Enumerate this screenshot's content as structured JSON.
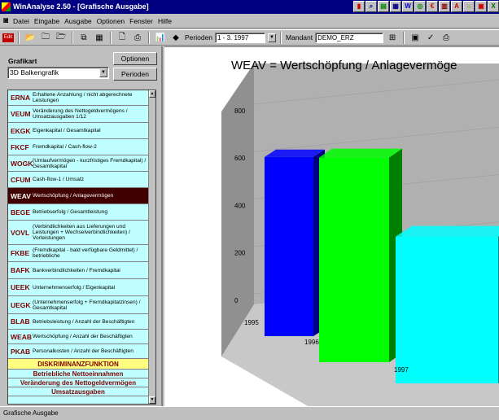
{
  "titlebar": {
    "title": "WinAnalyse 2.50 - [Grafische Ausgabe]"
  },
  "title_icons": [
    "chart-icon",
    "search-icon",
    "table-icon",
    "grid-icon",
    "word-icon",
    "money-icon",
    "euro-icon",
    "calc-icon",
    "pdf-icon",
    "bulb-icon",
    "save-icon",
    "excel-icon"
  ],
  "menu": [
    "Datei",
    "Eingabe",
    "Ausgabe",
    "Optionen",
    "Fenster",
    "Hilfe"
  ],
  "toolbar": {
    "perioden_label": "Perioden",
    "perioden_value": "1 - 3. 1997",
    "mandant_label": "Mandant",
    "mandant_value": "DEMO_ERZ"
  },
  "left": {
    "grafikart_label": "Grafikart",
    "grafik_value": "3D Balkengrafik",
    "optionen_btn": "Optionen",
    "perioden_btn": "Perioden",
    "items": [
      {
        "code": "ERNA",
        "desc": "Erhaltene Anzahlung / nicht abgerechnete Leistungen"
      },
      {
        "code": "VEUM",
        "desc": "Veränderung des Nettogeldvermögens / Umsatzausgaben 1/12"
      },
      {
        "code": "EKGK",
        "desc": "Eigenkapital / Gesamtkapital"
      },
      {
        "code": "FKCF",
        "desc": "Fremdkapital / Cash-flow-2"
      },
      {
        "code": "WOGK",
        "desc": "(Umlaufvermögen - kurzfristiges Fremdkapital) / Gesamtkapital"
      },
      {
        "code": "CFUM",
        "desc": "Cash-flow-1 / Umsatz"
      },
      {
        "code": "WEAV",
        "desc": "Wertschöpfung / Anlagevermögen",
        "selected": true
      },
      {
        "code": "BEGE",
        "desc": "Betriebserfolg / Gesamtleistung"
      },
      {
        "code": "VOVL",
        "desc": "(Verbindlichkeiten aus Lieferungen und Leistungen + Wechselverbindlichkeiten) / Vorleistungen"
      },
      {
        "code": "FKBE",
        "desc": "(Fremdkapital - bald verfügbare Geldmittel) / betriebliche"
      },
      {
        "code": "BAFK",
        "desc": "Bankverbindlichkeiten / Fremdkapital"
      },
      {
        "code": "UEEK",
        "desc": "Unternehmenserfolg / Eigenkapital"
      },
      {
        "code": "UEGK",
        "desc": "(Unternehmenserfolg + Fremdkapitalzinsen) / Gesamtkapital"
      },
      {
        "code": "BLAB",
        "desc": "Betriebsleistung / Anzahl der Beschäftigten"
      },
      {
        "code": "WEAB",
        "desc": "Wertschöpfung / Anzahl der Beschäftigten"
      },
      {
        "code": "PKAB",
        "desc": "Personalkosten / Anzahl der Beschäftigten"
      }
    ],
    "section1": "DISKRIMINANZFUNKTION",
    "section2": "Betriebliche Nettoeinnahmen",
    "section3": "Veränderung des Nettogeldvermögen",
    "section4": "Umsatzausgaben"
  },
  "chart_data": {
    "type": "bar",
    "title": "WEAV = Wertschöpfung / Anlagevermöge",
    "categories": [
      "1995",
      "1996",
      "1997"
    ],
    "values": [
      665,
      680,
      450
    ],
    "y_ticks": [
      "0",
      "200",
      "400",
      "600",
      "800"
    ],
    "ylim": [
      0,
      900
    ],
    "colors": [
      "#0000ff",
      "#00ff00",
      "#00ffff"
    ],
    "style": "3d"
  },
  "status": {
    "text": "Grafische Ausgabe"
  }
}
